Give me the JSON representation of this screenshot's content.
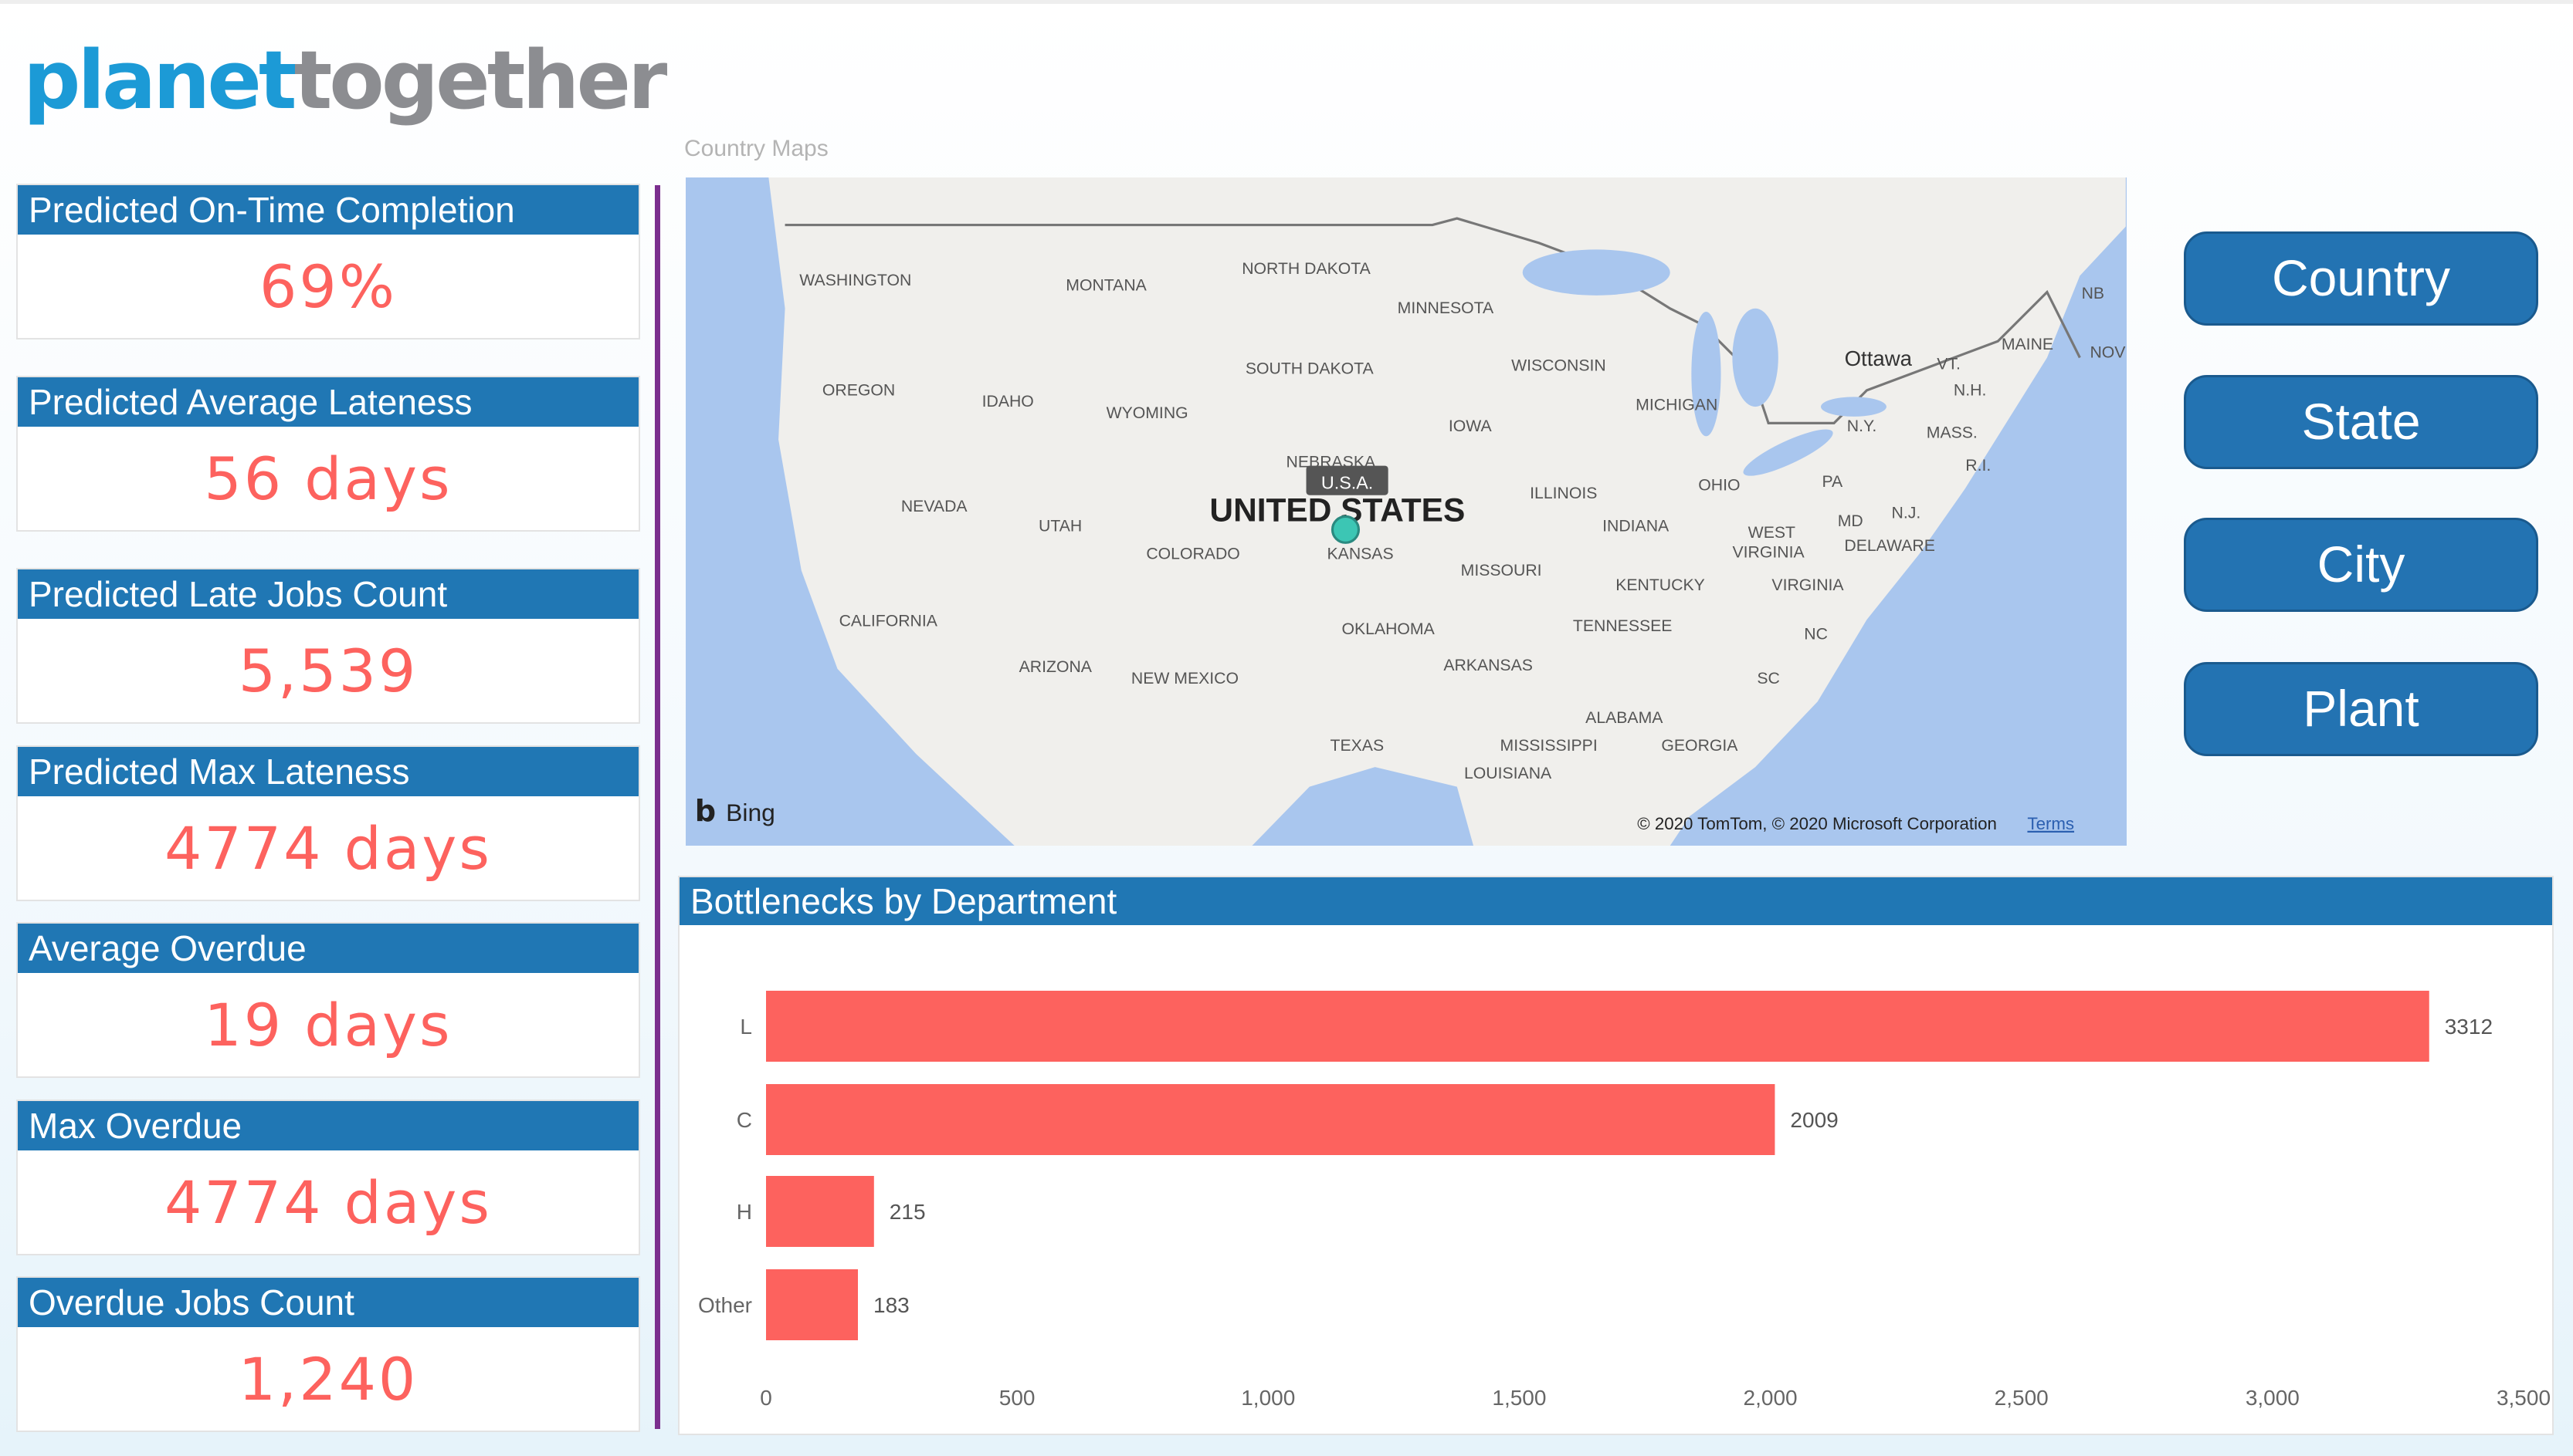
{
  "logo": {
    "part1": "planet",
    "part2": "together"
  },
  "kpis": [
    {
      "title": "Predicted On-Time Completion",
      "value": "69%"
    },
    {
      "title": "Predicted Average Lateness",
      "value": "56 days"
    },
    {
      "title": "Predicted Late Jobs Count",
      "value": "5,539"
    },
    {
      "title": "Predicted Max Lateness",
      "value": "4774 days"
    },
    {
      "title": "Average Overdue",
      "value": "19 days"
    },
    {
      "title": "Max Overdue",
      "value": "4774 days"
    },
    {
      "title": "Overdue Jobs Count",
      "value": "1,240"
    }
  ],
  "map": {
    "title": "Country Maps",
    "country_label": "UNITED STATES",
    "tooltip": "U.S.A.",
    "bing": "Bing",
    "copyright": "© 2020 TomTom, © 2020 Microsoft Corporation",
    "terms": "Terms",
    "marker_color": "#3cc6b4",
    "place_labels": [
      "WASHINGTON",
      "MONTANA",
      "NORTH DAKOTA",
      "MINNESOTA",
      "SOUTH DAKOTA",
      "WISCONSIN",
      "OREGON",
      "IDAHO",
      "WYOMING",
      "IOWA",
      "MICHIGAN",
      "NEBRASKA",
      "NEVADA",
      "UTAH",
      "COLORADO",
      "KANSAS",
      "ILLINOIS",
      "INDIANA",
      "OHIO",
      "PA",
      "MISSOURI",
      "WEST",
      "VIRGINIA",
      "MD",
      "N.J.",
      "DELAWARE",
      "KENTUCKY",
      "VIRGINIA",
      "CALIFORNIA",
      "OKLAHOMA",
      "TENNESSEE",
      "NC",
      "ARIZONA",
      "NEW MEXICO",
      "ARKANSAS",
      "SC",
      "ALABAMA",
      "TEXAS",
      "MISSISSIPPI",
      "GEORGIA",
      "LOUISIANA",
      "N.Y.",
      "MASS.",
      "VT.",
      "N.H.",
      "R.I.",
      "MAINE",
      "NB",
      "NOV",
      "Ottawa"
    ]
  },
  "buttons": [
    "Country",
    "State",
    "City",
    "Plant"
  ],
  "chart_data": {
    "type": "bar",
    "orientation": "horizontal",
    "title": "Bottlenecks by Department",
    "categories": [
      "L",
      "C",
      "H",
      "Other"
    ],
    "values": [
      3312,
      2009,
      215,
      183
    ],
    "xlim": [
      0,
      3500
    ],
    "xticks": [
      "0",
      "500",
      "1,000",
      "1,500",
      "2,000",
      "2,500",
      "3,000",
      "3,500"
    ],
    "xtick_values": [
      0,
      500,
      1000,
      1500,
      2000,
      2500,
      3000,
      3500
    ],
    "bar_color": "#fd625e",
    "data_labels": true,
    "grid": false
  },
  "colors": {
    "header": "#2077b4",
    "value": "#fd625e",
    "divider": "#7b2f8e",
    "button": "#2373b2"
  }
}
